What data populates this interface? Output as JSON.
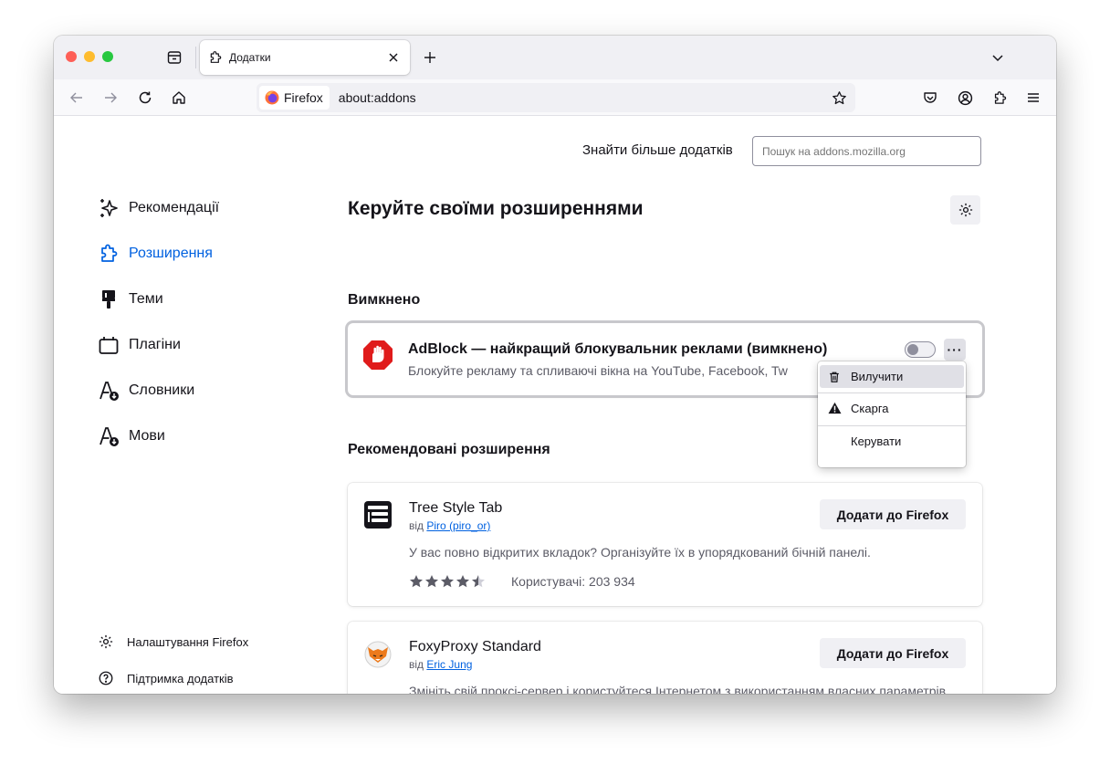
{
  "tab": {
    "title": "Додатки"
  },
  "urlbar": {
    "identity": "Firefox",
    "url": "about:addons"
  },
  "header": {
    "find_more": "Знайти більше додатків",
    "search_placeholder": "Пошук на addons.mozilla.org"
  },
  "sidebar": {
    "categories": [
      {
        "label": "Рекомендації",
        "icon": "sparkle-icon"
      },
      {
        "label": "Розширення",
        "icon": "puzzle-icon",
        "active": true
      },
      {
        "label": "Теми",
        "icon": "paintbrush-icon"
      },
      {
        "label": "Плагіни",
        "icon": "plugin-icon"
      },
      {
        "label": "Словники",
        "icon": "dictionary-icon"
      },
      {
        "label": "Мови",
        "icon": "language-icon"
      }
    ],
    "footer": {
      "settings": "Налаштування Firefox",
      "support": "Підтримка додатків"
    }
  },
  "main": {
    "title": "Керуйте своїми розширеннями",
    "disabled_heading": "Вимкнено",
    "recommended_heading": "Рекомендовані розширення",
    "disabled_addon": {
      "name": "AdBlock — найкращий блокувальник реклами (вимкнено)",
      "description": "Блокуйте рекламу та спливаючі вікна на YouTube, Facebook, Tw",
      "enabled": false,
      "more_label": "···"
    },
    "context_menu": {
      "remove": "Вилучити",
      "report": "Скарга",
      "manage": "Керувати"
    },
    "recommended": [
      {
        "name": "Tree Style Tab",
        "author_prefix": "від",
        "author": "Piro (piro_or)",
        "description": "У вас повно відкритих вкладок? Організуйте їх в упорядкований бічній панелі.",
        "add_label": "Додати до Firefox",
        "rating": 4.5,
        "users": "Користувачі: 203 934"
      },
      {
        "name": "FoxyProxy Standard",
        "author_prefix": "від",
        "author": "Eric Jung",
        "description": "Змініть свій проксі-сервер і користуйтеся Інтернетом з використанням власних параметрів проксі.",
        "add_label": "Додати до Firefox"
      }
    ]
  },
  "colors": {
    "accent": "#0061e0",
    "adblock_red": "#e01b1b",
    "traffic_red": "#fe5f57",
    "traffic_yellow": "#febc2e",
    "traffic_green": "#28c840"
  }
}
